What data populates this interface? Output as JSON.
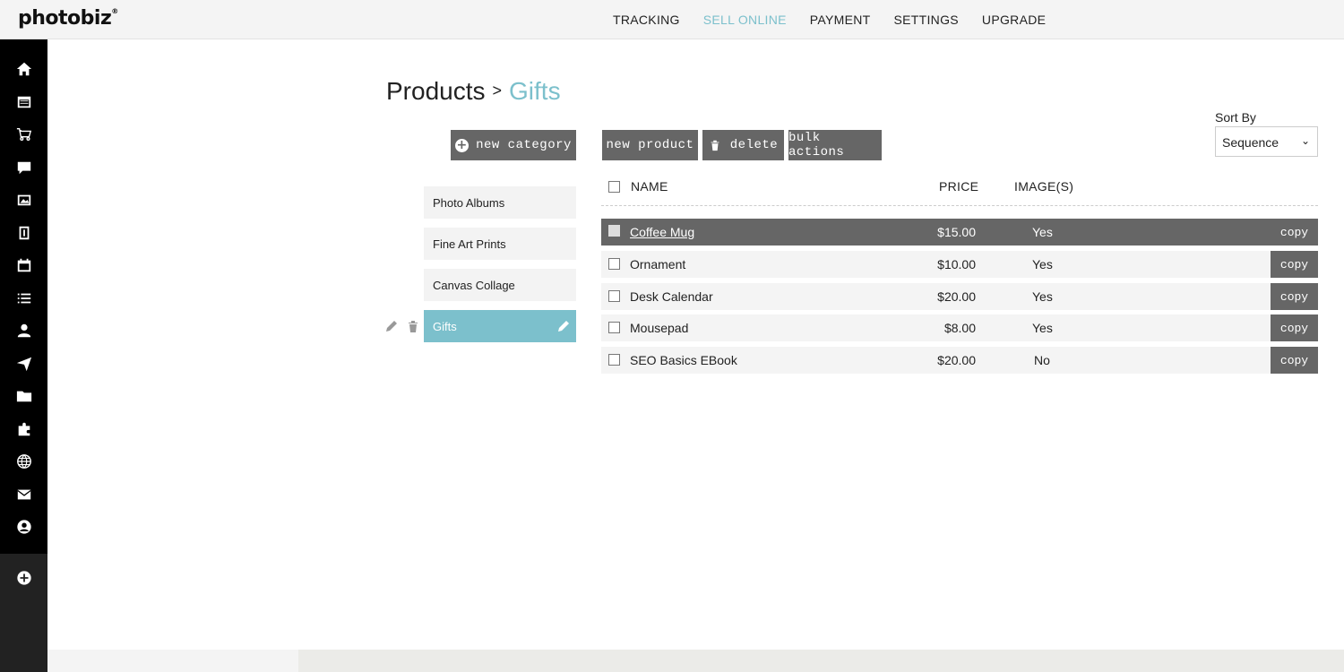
{
  "app": {
    "logo": "photobiz",
    "logo_mark": "®"
  },
  "topnav": [
    {
      "label": "TRACKING",
      "active": false
    },
    {
      "label": "SELL ONLINE",
      "active": true
    },
    {
      "label": "PAYMENT",
      "active": false
    },
    {
      "label": "SETTINGS",
      "active": false
    },
    {
      "label": "UPGRADE",
      "active": false
    }
  ],
  "rail_icons": [
    "home-icon",
    "website-icon",
    "cart-icon",
    "chat-icon",
    "gallery-icon",
    "invoice-icon",
    "calendar-icon",
    "list-icon",
    "contacts-icon",
    "send-icon",
    "folder-icon",
    "plugin-icon",
    "globe-icon",
    "mail-icon",
    "account-icon",
    "add-icon"
  ],
  "breadcrumb": {
    "root": "Products",
    "separator": ">",
    "current": "Gifts"
  },
  "buttons": {
    "new_category": "new category",
    "new_product": "new product",
    "delete": "delete",
    "bulk_actions": "bulk actions"
  },
  "sort": {
    "label": "Sort By",
    "value": "Sequence"
  },
  "categories": [
    {
      "label": "Photo Albums",
      "selected": false
    },
    {
      "label": "Fine Art Prints",
      "selected": false
    },
    {
      "label": "Canvas Collage",
      "selected": false
    },
    {
      "label": "Gifts",
      "selected": true
    }
  ],
  "table": {
    "headers": {
      "name": "NAME",
      "price": "PRICE",
      "images": "IMAGE(S)"
    },
    "copy_label": "copy",
    "rows": [
      {
        "name": "Coffee Mug",
        "price": "$15.00",
        "images": "Yes",
        "highlighted": true
      },
      {
        "name": "Ornament",
        "price": "$10.00",
        "images": "Yes",
        "highlighted": false
      },
      {
        "name": "Desk Calendar",
        "price": "$20.00",
        "images": "Yes",
        "highlighted": false
      },
      {
        "name": "Mousepad",
        "price": "$8.00",
        "images": "Yes",
        "highlighted": false
      },
      {
        "name": "SEO Basics EBook",
        "price": "$20.00",
        "images": "No",
        "highlighted": false
      }
    ]
  },
  "colors": {
    "accent": "#7cc0cc",
    "button": "#666666",
    "rail": "#000000"
  }
}
